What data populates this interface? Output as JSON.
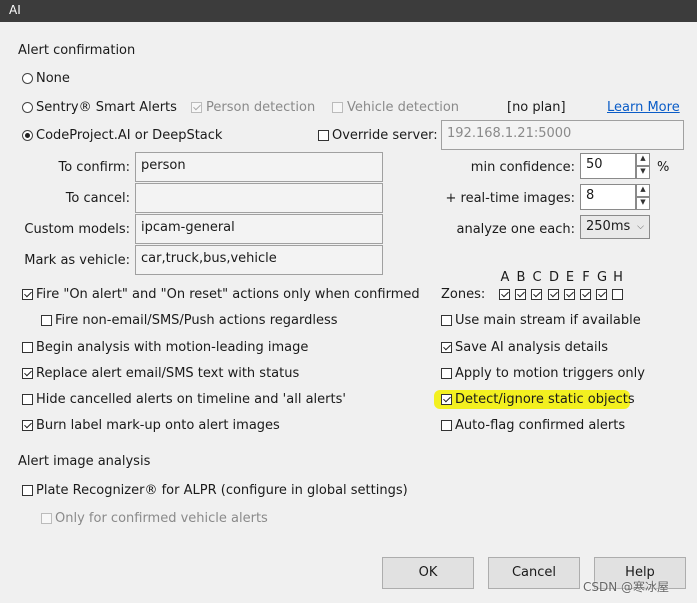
{
  "window": {
    "title": "AI"
  },
  "confirmation": {
    "heading": "Alert confirmation",
    "opt_none": "None",
    "opt_sentry": "Sentry® Smart Alerts",
    "person_detection": "Person detection",
    "vehicle_detection": "Vehicle detection",
    "plan": "[no plan]",
    "learn_more": "Learn More",
    "opt_codeproject": "CodeProject.AI or DeepStack",
    "override_server": "Override server:",
    "server_value": "192.168.1.21:5000"
  },
  "fields": {
    "to_confirm_label": "To confirm:",
    "to_confirm_value": "person",
    "to_cancel_label": "To cancel:",
    "to_cancel_value": "",
    "custom_models_label": "Custom models:",
    "custom_models_value": "ipcam-general",
    "mark_vehicle_label": "Mark as vehicle:",
    "mark_vehicle_value": "car,truck,bus,vehicle",
    "min_conf_label": "min confidence:",
    "min_conf_value": "50",
    "min_conf_unit": "%",
    "realtime_label": "+ real-time images:",
    "realtime_value": "8",
    "analyze_label": "analyze one each:",
    "analyze_value": "250ms"
  },
  "zones": {
    "label": "Zones:",
    "letters": [
      "A",
      "B",
      "C",
      "D",
      "E",
      "F",
      "G",
      "H"
    ],
    "checked": [
      true,
      true,
      true,
      true,
      true,
      true,
      true,
      false
    ]
  },
  "left_opts": {
    "fire_on_alert": "Fire \"On alert\" and \"On reset\" actions only when confirmed",
    "fire_non_email": "Fire non-email/SMS/Push actions regardless",
    "begin_analysis": "Begin analysis with motion-leading image",
    "replace_alert": "Replace alert email/SMS text with status",
    "hide_cancelled": "Hide cancelled alerts on timeline and  'all alerts'",
    "burn_label": "Burn label mark-up onto alert images"
  },
  "right_opts": {
    "use_main_stream": "Use main stream if available",
    "save_ai": "Save AI analysis details",
    "apply_motion": "Apply to motion triggers only",
    "detect_static": "Detect/ignore static objects",
    "auto_flag": "Auto-flag confirmed alerts"
  },
  "image_analysis": {
    "heading": "Alert image analysis",
    "plate": "Plate Recognizer® for ALPR (configure in global settings)",
    "only_vehicle": "Only for confirmed vehicle alerts"
  },
  "buttons": {
    "ok": "OK",
    "cancel": "Cancel",
    "help": "Help"
  },
  "watermark": "CSDN @寒冰屋",
  "colors": {
    "highlight": "#f3f020",
    "link": "#0a5cc7",
    "titlebar": "#3c3c3c"
  }
}
